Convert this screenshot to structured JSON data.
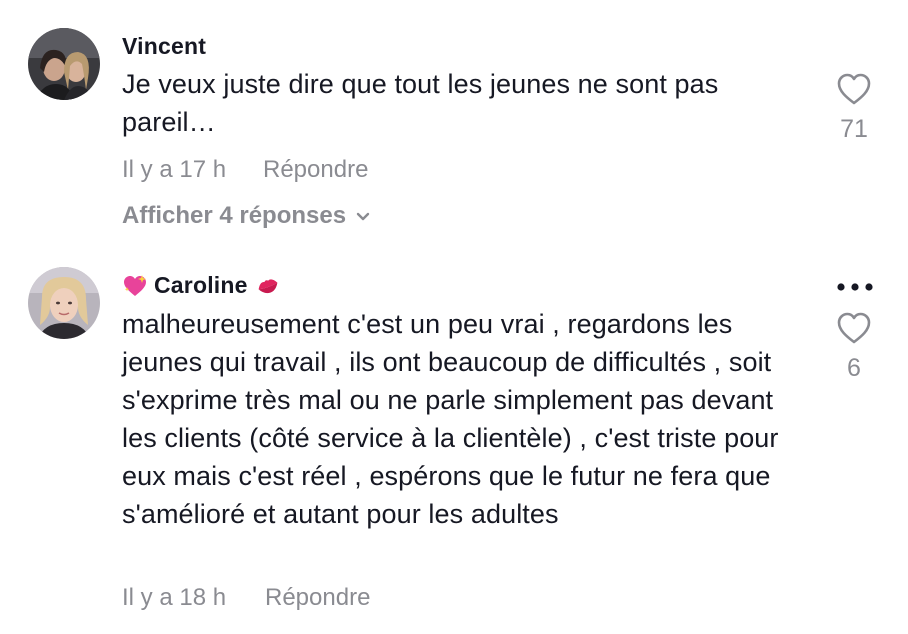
{
  "comments": [
    {
      "username": "Vincent",
      "text": "Je veux juste dire que tout les jeunes ne sont pas pareil…",
      "time": "Il y a 17 h",
      "reply_label": "Répondre",
      "likes": "71",
      "view_replies_label": "Afficher 4 réponses",
      "avatar_icon": "user-avatar-photo"
    },
    {
      "username": "Caroline",
      "username_prefix_icon": "sparkling-heart-emoji",
      "username_suffix_icon": "kiss-mark-emoji",
      "text": "malheureusement c'est un peu vrai , regardons les jeunes qui travail , ils ont beaucoup de difficultés , soit s'exprime très mal ou ne parle simplement pas devant les clients (côté service à la clientèle) , c'est triste pour eux mais c'est réel , espérons que le futur ne fera que s'amélioré et autant pour les adultes",
      "time": "Il y a 18 h",
      "reply_label": "Répondre",
      "likes": "6",
      "more_icon": "more-options-icon",
      "avatar_icon": "user-avatar-photo"
    }
  ],
  "colors": {
    "text": "#161823",
    "muted": "#8a8b91",
    "emoji_heart": "#e8439a",
    "emoji_kiss": "#e0245e"
  }
}
